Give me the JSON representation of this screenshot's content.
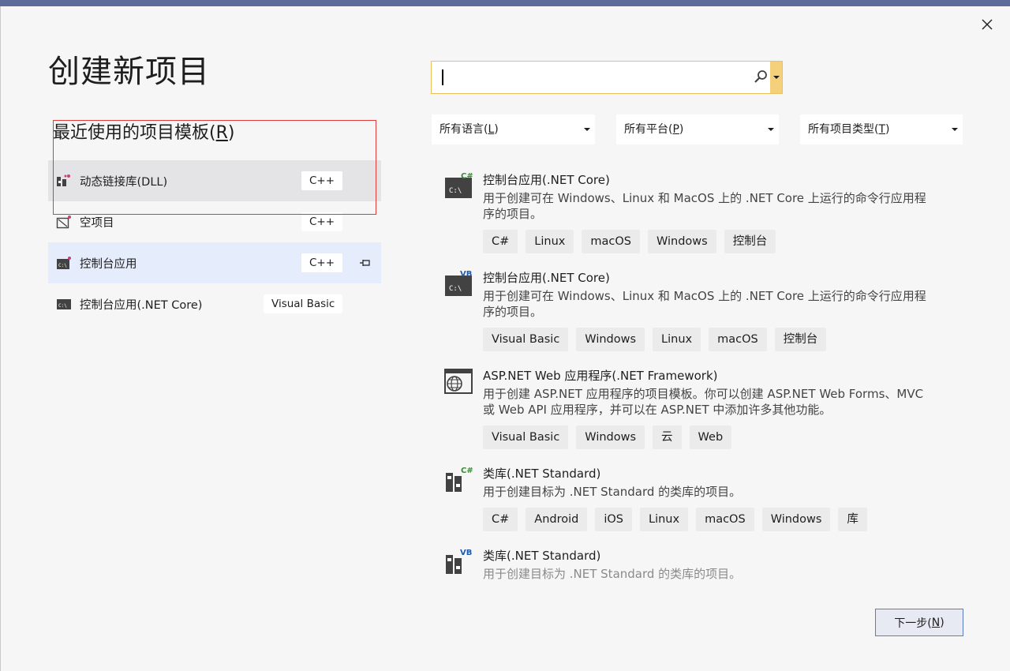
{
  "window": {
    "title": "创建新项目",
    "close_icon": "close-icon",
    "accent_color": "#5d6b99"
  },
  "recent": {
    "heading": "最近使用的项目模板(",
    "heading_key": "R",
    "heading_end": ")",
    "items": [
      {
        "label": "动态链接库(DLL)",
        "tag": "C++",
        "icon": "dll-icon",
        "state": "hover",
        "pinned": false
      },
      {
        "label": "空项目",
        "tag": "C++",
        "icon": "empty-project-icon",
        "state": "normal",
        "pinned": false
      },
      {
        "label": "控制台应用",
        "tag": "C++",
        "icon": "console-app-icon",
        "state": "selected",
        "pinned": true
      },
      {
        "label": "控制台应用(.NET Core)",
        "tag": "Visual Basic",
        "icon": "console-app-icon",
        "state": "normal",
        "pinned": false
      }
    ]
  },
  "search": {
    "value": "",
    "icon": "search-icon"
  },
  "filters": [
    {
      "label": "所有语言(",
      "key": "L",
      "end": ")"
    },
    {
      "label": "所有平台(",
      "key": "P",
      "end": ")"
    },
    {
      "label": "所有项目类型(",
      "key": "T",
      "end": ")"
    }
  ],
  "templates": [
    {
      "name": "控制台应用(.NET Core)",
      "badge": "C#",
      "desc": "用于创建可在 Windows、Linux 和 MacOS 上的 .NET Core 上运行的命令行应用程序的项目。",
      "tags": [
        "C#",
        "Linux",
        "macOS",
        "Windows",
        "控制台"
      ]
    },
    {
      "name": "控制台应用(.NET Core)",
      "badge": "VB",
      "desc": "用于创建可在 Windows、Linux 和 MacOS 上的 .NET Core 上运行的命令行应用程序的项目。",
      "tags": [
        "Visual Basic",
        "Windows",
        "Linux",
        "macOS",
        "控制台"
      ]
    },
    {
      "name": "ASP.NET Web 应用程序(.NET Framework)",
      "badge": "",
      "desc": "用于创建 ASP.NET 应用程序的项目模板。你可以创建 ASP.NET Web Forms、MVC 或 Web API 应用程序，并可以在 ASP.NET 中添加许多其他功能。",
      "tags": [
        "Visual Basic",
        "Windows",
        "云",
        "Web"
      ]
    },
    {
      "name": "类库(.NET Standard)",
      "badge": "C#",
      "desc": "用于创建目标为 .NET Standard 的类库的项目。",
      "tags": [
        "C#",
        "Android",
        "iOS",
        "Linux",
        "macOS",
        "Windows",
        "库"
      ]
    },
    {
      "name": "类库(.NET Standard)",
      "badge": "VB",
      "desc": "用于创建目标为 .NET Standard 的类库的项目。",
      "tags": []
    }
  ],
  "footer": {
    "next_label": "下一步(",
    "next_key": "N",
    "next_end": ")"
  }
}
